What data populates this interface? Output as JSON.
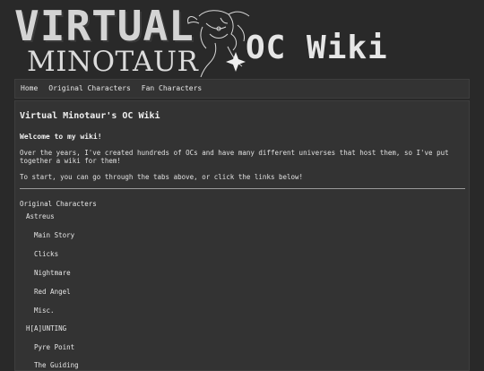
{
  "header": {
    "logo_virtual": "VIRTUAL",
    "logo_minotaur": "MINOTAUR",
    "logo_wiki": "OC Wiki",
    "logo_art": "minotaur-line-art-icon"
  },
  "nav": {
    "items": [
      {
        "label": "Home"
      },
      {
        "label": "Original Characters"
      },
      {
        "label": "Fan Characters"
      }
    ]
  },
  "main": {
    "title": "Virtual Minotaur's OC Wiki",
    "welcome": "Welcome to my wiki!",
    "intro": "Over the years, I've created hundreds of OCs and have many different universes that host them, so I've put together a wiki for them!",
    "instructions": "To start, you can go through the tabs above, or click the links below!",
    "list": {
      "heading": "Original Characters",
      "groups": [
        {
          "label": "Astreus",
          "items": [
            "Main Story",
            "Clicks",
            "Nightmare",
            "Red Angel",
            "Misc."
          ]
        },
        {
          "label": "H[A]UNTING",
          "items": [
            "Pyre Point",
            "The Guiding"
          ]
        }
      ]
    }
  },
  "colors": {
    "background": "#292929",
    "panel": "#333333",
    "text": "#e6e6e6"
  }
}
